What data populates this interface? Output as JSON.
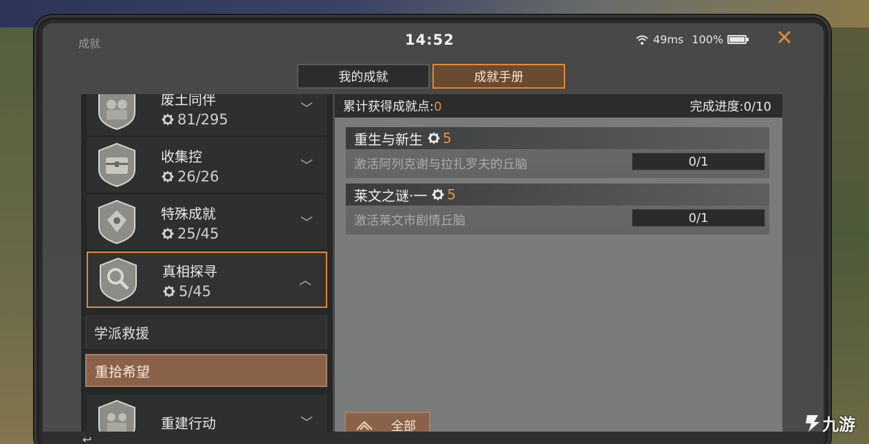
{
  "status": {
    "title": "成就",
    "time": "14:52",
    "ping": "49ms",
    "battery": "100%",
    "close_icon": "close-icon"
  },
  "tabs": [
    {
      "label": "我的成就",
      "active": false
    },
    {
      "label": "成就手册",
      "active": true
    }
  ],
  "categories": [
    {
      "name": "废土同伴",
      "score": "81/295",
      "icon": "companion-badge-icon",
      "expanded": false
    },
    {
      "name": "收集控",
      "score": "26/26",
      "icon": "chest-badge-icon",
      "expanded": false
    },
    {
      "name": "特殊成就",
      "score": "25/45",
      "icon": "special-badge-icon",
      "expanded": false
    },
    {
      "name": "真相探寻",
      "score": "5/45",
      "icon": "magnifier-badge-icon",
      "expanded": true
    },
    {
      "name": "重建行动",
      "score": "",
      "icon": "rebuild-badge-icon",
      "expanded": false
    }
  ],
  "subcategories": [
    {
      "label": "学派救援",
      "active": false
    },
    {
      "label": "重拾希望",
      "active": true
    }
  ],
  "summary": {
    "points_label": "累计获得成就点:",
    "points_value": "0",
    "progress_label": "完成进度:",
    "progress_value": "0/10"
  },
  "achievements": [
    {
      "title": "重生与新生",
      "points": "5",
      "desc": "激活阿列克谢与拉扎罗夫的丘脑",
      "progress": "0/1"
    },
    {
      "title": "莱文之谜·一",
      "points": "5",
      "desc": "激活莱文市剧情丘脑",
      "progress": "0/1"
    }
  ],
  "all_button": {
    "label": "全部"
  },
  "watermark": {
    "text": "九游"
  },
  "colors": {
    "accent": "#e08a3a",
    "active_bg": "#8a6249",
    "panel_bg": "#262727"
  }
}
